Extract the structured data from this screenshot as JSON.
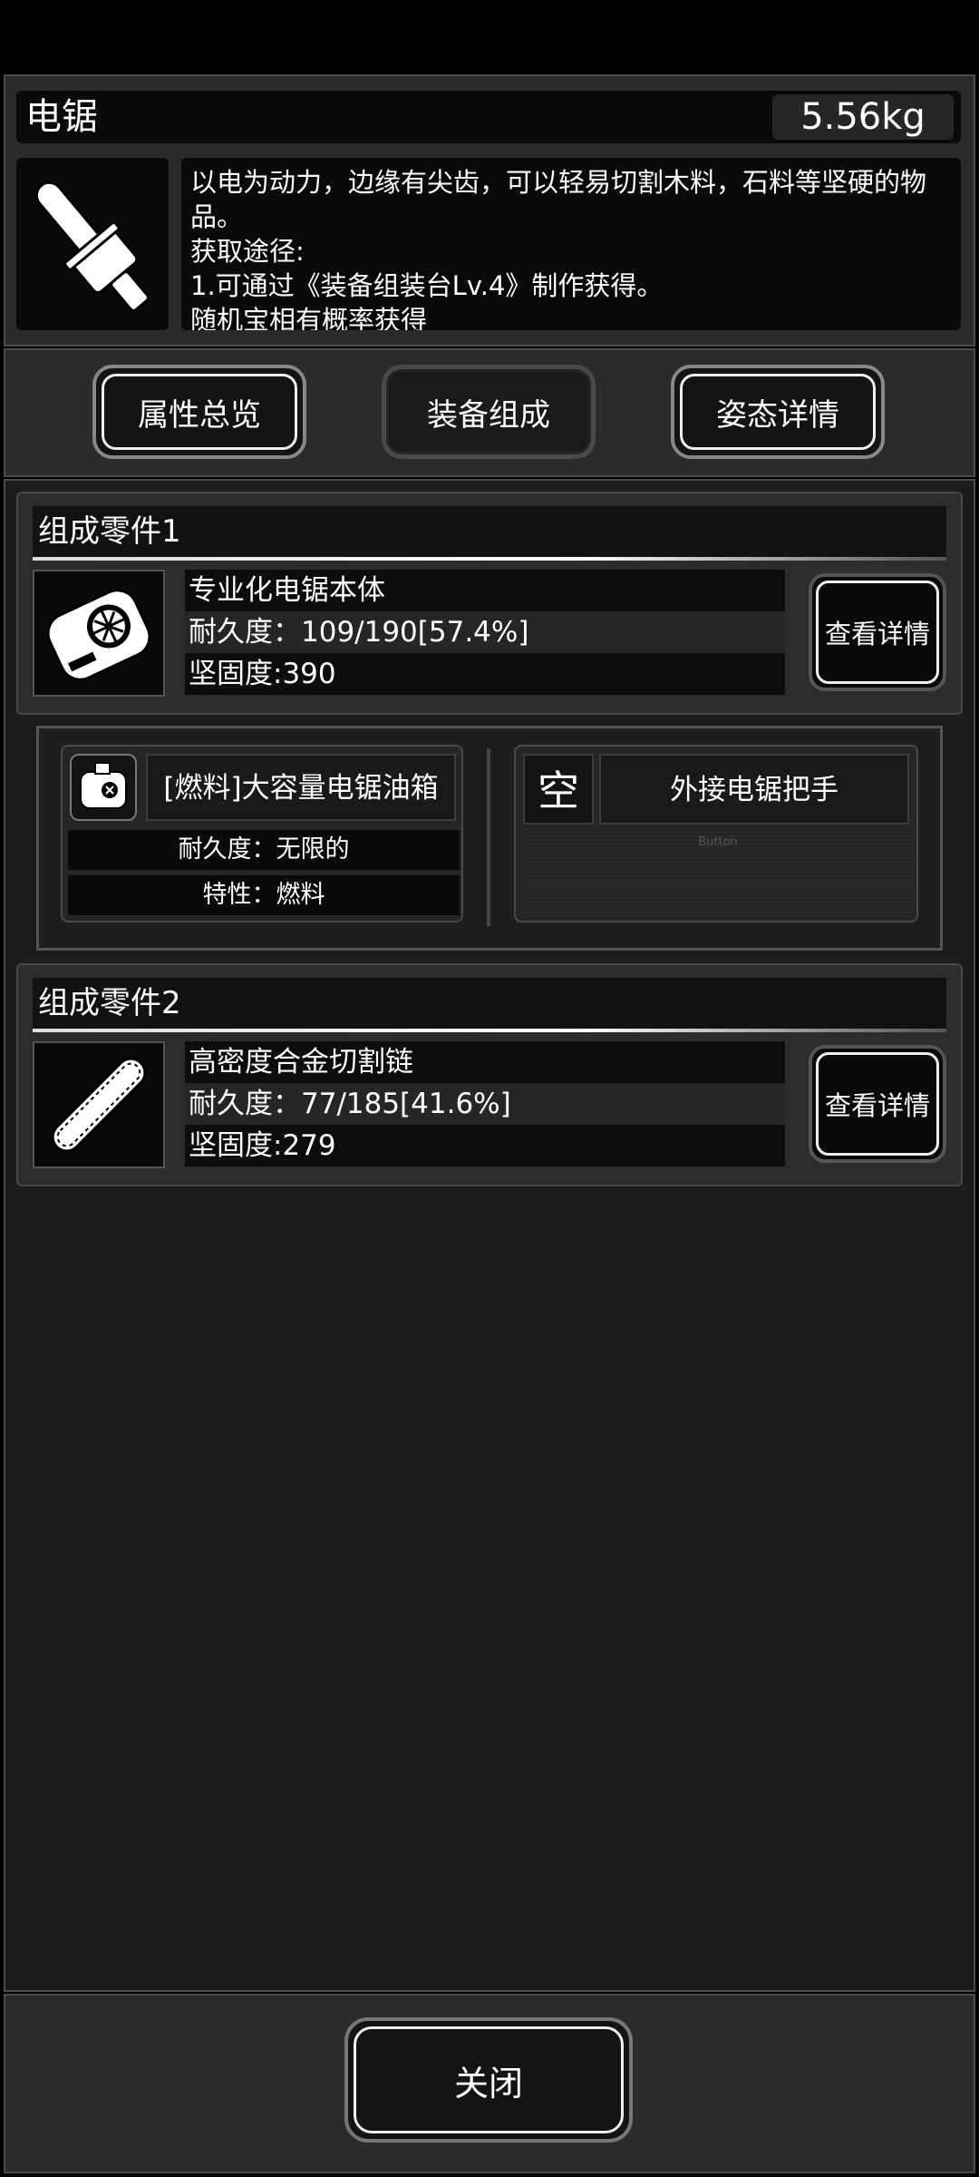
{
  "item": {
    "name": "电锯",
    "weight": "5.56kg",
    "icon": "chainsaw-icon",
    "description_lines": [
      "以电为动力，边缘有尖齿，可以轻易切割木料，石料等坚硬的物",
      "品。",
      "获取途径:",
      "1.可通过《装备组装台Lv.4》制作获得。",
      "随机宝相有概率获得"
    ]
  },
  "tabs": [
    {
      "label": "属性总览",
      "active": false
    },
    {
      "label": "装备组成",
      "active": true
    },
    {
      "label": "姿态详情",
      "active": false
    }
  ],
  "parts": [
    {
      "title": "组成零件1",
      "icon": "chainsaw-motor-icon",
      "name": "专业化电锯本体",
      "durability": "耐久度：109/190[57.4%]",
      "hardness": "坚固度:390",
      "detail_label": "查看详情"
    },
    {
      "title": "组成零件2",
      "icon": "chainsaw-bar-icon",
      "name": "高密度合金切割链",
      "durability": "耐久度：77/185[41.6%]",
      "hardness": "坚固度:279",
      "detail_label": "查看详情"
    }
  ],
  "attachments": {
    "slot_a": {
      "icon": "fuel-tank-icon",
      "name": "[燃料]大容量电锯油箱",
      "durability": "耐久度：无限的",
      "trait": "特性：燃料"
    },
    "slot_b": {
      "empty_char": "空",
      "name": "外接电锯把手",
      "button_label": "Button"
    }
  },
  "close_label": "关闭",
  "colors": {
    "accent": "#ffffff",
    "panel": "#2b2b2b",
    "background": "#1c1c1c"
  }
}
